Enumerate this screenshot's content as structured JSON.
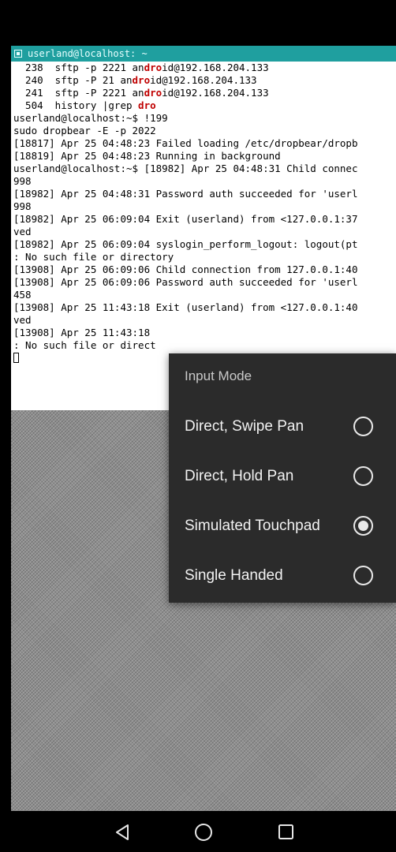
{
  "terminal": {
    "title": "userland@localhost: ~",
    "lines": [
      [
        {
          "t": "  238  sftp -p 2221 an"
        },
        {
          "t": "dro",
          "h": true
        },
        {
          "t": "id@192.168.204.133"
        }
      ],
      [
        {
          "t": "  240  sftp -P 21 an"
        },
        {
          "t": "dro",
          "h": true
        },
        {
          "t": "id@192.168.204.133"
        }
      ],
      [
        {
          "t": "  241  sftp -P 2221 an"
        },
        {
          "t": "dro",
          "h": true
        },
        {
          "t": "id@192.168.204.133"
        }
      ],
      [
        {
          "t": "  504  history |grep "
        },
        {
          "t": "dro",
          "h": true
        }
      ],
      [
        {
          "t": "userland@localhost:~$ !199"
        }
      ],
      [
        {
          "t": "sudo dropbear -E -p 2022"
        }
      ],
      [
        {
          "t": "[18817] Apr 25 04:48:23 Failed loading /etc/dropbear/dropb"
        }
      ],
      [
        {
          "t": "[18819] Apr 25 04:48:23 Running in background"
        }
      ],
      [
        {
          "t": "userland@localhost:~$ [18982] Apr 25 04:48:31 Child connec"
        }
      ],
      [
        {
          "t": "998"
        }
      ],
      [
        {
          "t": "[18982] Apr 25 04:48:31 Password auth succeeded for 'userl"
        }
      ],
      [
        {
          "t": "998"
        }
      ],
      [
        {
          "t": "[18982] Apr 25 06:09:04 Exit (userland) from <127.0.0.1:37"
        }
      ],
      [
        {
          "t": "ved"
        }
      ],
      [
        {
          "t": "[18982] Apr 25 06:09:04 syslogin_perform_logout: logout(pt"
        }
      ],
      [
        {
          "t": ": No such file or directory"
        }
      ],
      [
        {
          "t": "[13908] Apr 25 06:09:06 Child connection from 127.0.0.1:40"
        }
      ],
      [
        {
          "t": "[13908] Apr 25 06:09:06 Password auth succeeded for 'userl"
        }
      ],
      [
        {
          "t": "458"
        }
      ],
      [
        {
          "t": "[13908] Apr 25 11:43:18 Exit (userland) from <127.0.0.1:40"
        }
      ],
      [
        {
          "t": "ved"
        }
      ],
      [
        {
          "t": "[13908] Apr 25 11:43:18 "
        }
      ],
      [
        {
          "t": ": No such file or direct"
        }
      ]
    ]
  },
  "input_mode_menu": {
    "title": "Input Mode",
    "options": [
      {
        "label": "Direct, Swipe Pan",
        "selected": false
      },
      {
        "label": "Direct, Hold Pan",
        "selected": false
      },
      {
        "label": "Simulated Touchpad",
        "selected": true
      },
      {
        "label": "Single Handed",
        "selected": false
      }
    ]
  },
  "nav": {
    "back_icon": "back-triangle-icon",
    "home_icon": "home-circle-icon",
    "recents_icon": "recents-square-icon"
  },
  "colors": {
    "title_bar": "#1f9f9f",
    "highlight": "#c00000",
    "menu_bg": "#2b2b2b"
  }
}
